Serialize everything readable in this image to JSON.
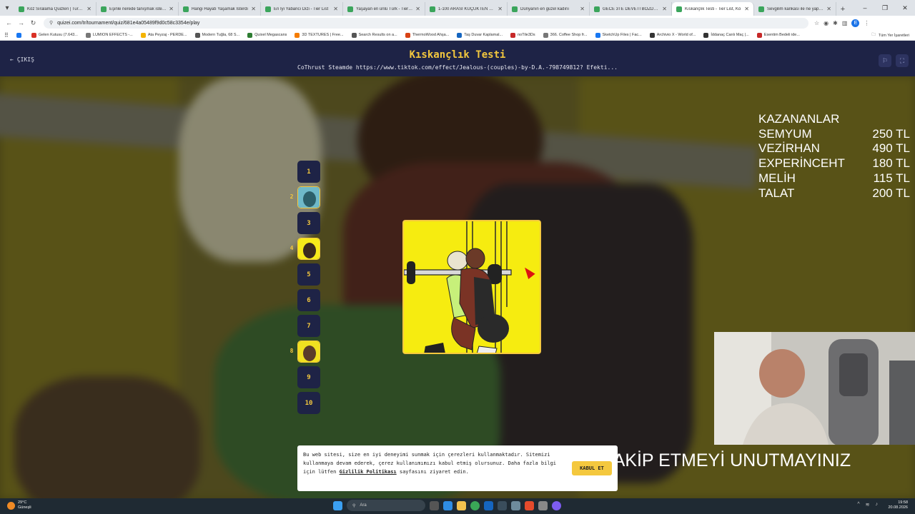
{
  "browser": {
    "tabs": [
      {
        "title": "Köz Sıralama Quizleri | Turnuva",
        "active": false
      },
      {
        "title": "Eşinle nerede tanışmak isterdi",
        "active": false
      },
      {
        "title": "Hangi Hayatı Yaşamak İsterdi",
        "active": false
      },
      {
        "title": "En İyi Yabancı Dizi - Tier List",
        "active": false
      },
      {
        "title": "Yaşayan en ünlü Türk - Tier List",
        "active": false
      },
      {
        "title": "1-100 ARASI KÜÇÜKTEN BÜYÜ",
        "active": false
      },
      {
        "title": "Dünyanın en güzel kadını",
        "active": false
      },
      {
        "title": "GECE 3TE DEVETİ BOZDURUR",
        "active": false
      },
      {
        "title": "Kıskançlık Testi - Tier List, Kö",
        "active": true
      },
      {
        "title": "Sevgilim kankası ile ne yapsın",
        "active": false
      }
    ],
    "url": "quizei.com/tr/tournament/quiz/681e4a05489f9d0c58c3354e/play",
    "profile_letter": "E",
    "bookmarks": [
      {
        "label": "",
        "color": "#1877f2"
      },
      {
        "label": "Gelen Kutusu (7.643...",
        "color": "#d93025"
      },
      {
        "label": "LUMION EFFECTS -...",
        "color": "#777777"
      },
      {
        "label": "Ata Peyzaj - PERDE...",
        "color": "#f4b400"
      },
      {
        "label": "Modern Tuğla, 68 S...",
        "color": "#555555"
      },
      {
        "label": "Quixel Megascans",
        "color": "#2e7d32"
      },
      {
        "label": "3D TEXTURES | Free...",
        "color": "#f57c00"
      },
      {
        "label": "Search Results on a...",
        "color": "#555555"
      },
      {
        "label": "ThermoWood Ahşa...",
        "color": "#d84315"
      },
      {
        "label": "Taş Duvar Kaplamal...",
        "color": "#1565c0"
      },
      {
        "label": "noTile3Ds",
        "color": "#c62828"
      },
      {
        "label": "366. Coffee Shop fr...",
        "color": "#777777"
      },
      {
        "label": "SketchUp Files | Fac...",
        "color": "#1877f2"
      },
      {
        "label": "Archivio X - World of...",
        "color": "#333333"
      },
      {
        "label": "İddanaç Canlı Maç |...",
        "color": "#333333"
      },
      {
        "label": "Esentim Bedeli ide...",
        "color": "#c62828"
      }
    ],
    "bookmarks_right": "Tüm Yer İşaretleri"
  },
  "header": {
    "exit_label": "ÇIKIŞ",
    "title": "Kıskançlık Testi",
    "subtitle": "CoThrust Steamde https://www.tiktok.com/effect/Jealous-(couples)-by-D.A.-798749812? Efekti..."
  },
  "rounds": [
    {
      "label": "1",
      "thumb": false
    },
    {
      "label": "2",
      "thumb": true,
      "side_index": "2",
      "thumb_colors": [
        "#6fb9c9",
        "#2c5f6a"
      ]
    },
    {
      "label": "3",
      "thumb": false
    },
    {
      "label": "4",
      "thumb": true,
      "side_index": "4",
      "thumb_colors": [
        "#f7ea1a",
        "#3b2a1f"
      ]
    },
    {
      "label": "5",
      "thumb": false
    },
    {
      "label": "6",
      "thumb": false
    },
    {
      "label": "7",
      "thumb": false
    },
    {
      "label": "8",
      "thumb": true,
      "side_index": "8",
      "thumb_colors": [
        "#f0e020",
        "#5a3b2a"
      ]
    },
    {
      "label": "9",
      "thumb": false
    },
    {
      "label": "10",
      "thumb": false
    }
  ],
  "overlay": {
    "winners_title": "KAZANANLAR",
    "winners": [
      {
        "name": "SEMYUM",
        "amount": "250 TL"
      },
      {
        "name": "VEZİRHAN",
        "amount": "490 TL"
      },
      {
        "name": "EXPERİNCEHT",
        "amount": "180 TL"
      },
      {
        "name": "MELİH",
        "amount": "115 TL"
      },
      {
        "name": "TALAT",
        "amount": "200 TL"
      }
    ],
    "marquee": "AR TAKİP ETMEYİ UNUTMAYINIZ"
  },
  "cookie": {
    "text": "Bu web sitesi, size en iyi deneyimi sunmak için çerezleri kullanmaktadır. Sitemizi kullanmaya devam ederek, çerez kullanımımızı kabul etmiş olursunuz. Daha fazla bilgi için lütfen",
    "link": "Gizlilik Politikası",
    "suffix": "sayfasını ziyaret edin.",
    "accept_label": "KABUL ET"
  },
  "taskbar": {
    "weather_temp": "29°C",
    "weather_desc": "Güneşli",
    "search_placeholder": "Ara",
    "time": "19:58",
    "date": "20.08.2026"
  },
  "colors": {
    "accent": "#f4c83e",
    "header_bg": "#1e2346"
  }
}
